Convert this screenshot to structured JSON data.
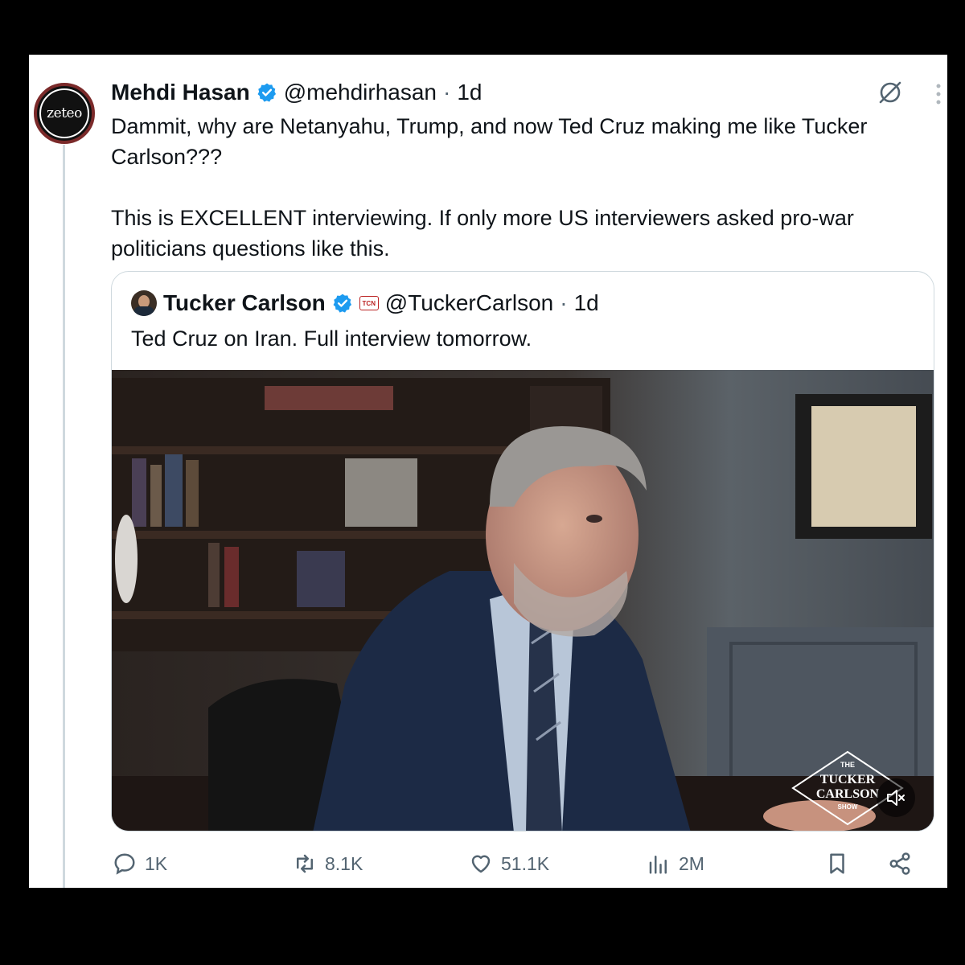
{
  "author": {
    "name": "Mehdi Hasan",
    "handle": "@mehdirhasan",
    "separator": "·",
    "time": "1d",
    "avatar_text": "zeteo"
  },
  "tweet": {
    "text": "Dammit, why are Netanyahu, Trump, and now Ted Cruz making me like Tucker Carlson???\n\nThis is EXCELLENT interviewing. If only more US interviewers asked pro-war politicians questions like this."
  },
  "quote": {
    "name": "Tucker Carlson",
    "badge_text": "TCN",
    "handle": "@TuckerCarlson",
    "separator": "·",
    "time": "1d",
    "text": "Ted Cruz on Iran. Full interview tomorrow.",
    "watermark": {
      "line1": "THE",
      "line2": "TUCKER",
      "line3": "CARLSON",
      "line4": "SHOW"
    }
  },
  "actions": {
    "replies": "1K",
    "reposts": "8.1K",
    "likes": "51.1K",
    "views": "2M"
  },
  "colors": {
    "verified": "#1d9bf0",
    "muted_text": "#536471",
    "border": "#cfd9de"
  },
  "icons": [
    "grok-icon",
    "more-icon",
    "verified-icon",
    "reply-icon",
    "repost-icon",
    "like-icon",
    "views-icon",
    "bookmark-icon",
    "share-icon",
    "mute-icon"
  ]
}
